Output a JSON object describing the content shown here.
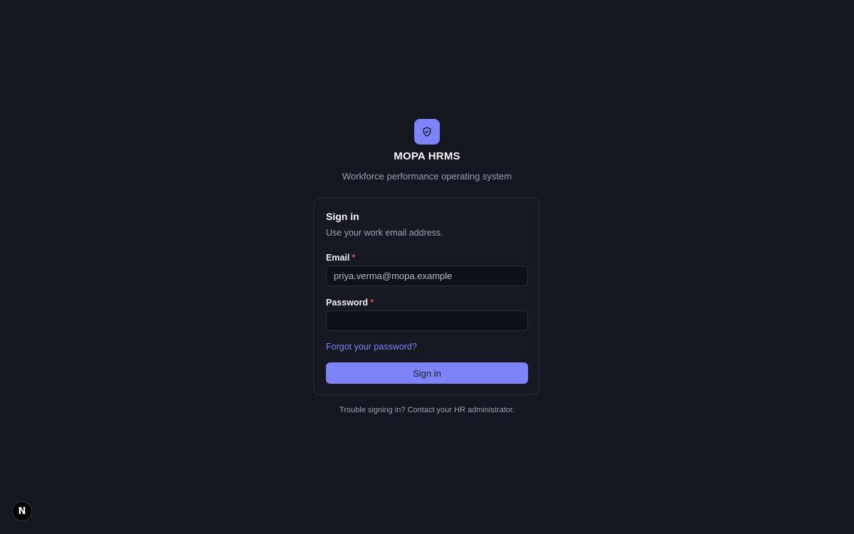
{
  "brand": {
    "logo_icon": "shield-check-icon",
    "title": "MOPA HRMS",
    "tagline": "Workforce performance operating system",
    "accent_color": "#7c84f8"
  },
  "signin_card": {
    "title": "Sign in",
    "subtitle": "Use your work email address.",
    "email": {
      "label": "Email",
      "required_mark": "*",
      "value": "priya.verma@mopa.example"
    },
    "password": {
      "label": "Password",
      "required_mark": "*",
      "value": ""
    },
    "forgot_link": "Forgot your password?",
    "submit_label": "Sign in"
  },
  "help_text": "Trouble signing in? Contact your HR administrator.",
  "dev_badge": {
    "icon": "nextjs-icon",
    "letter": "N"
  }
}
